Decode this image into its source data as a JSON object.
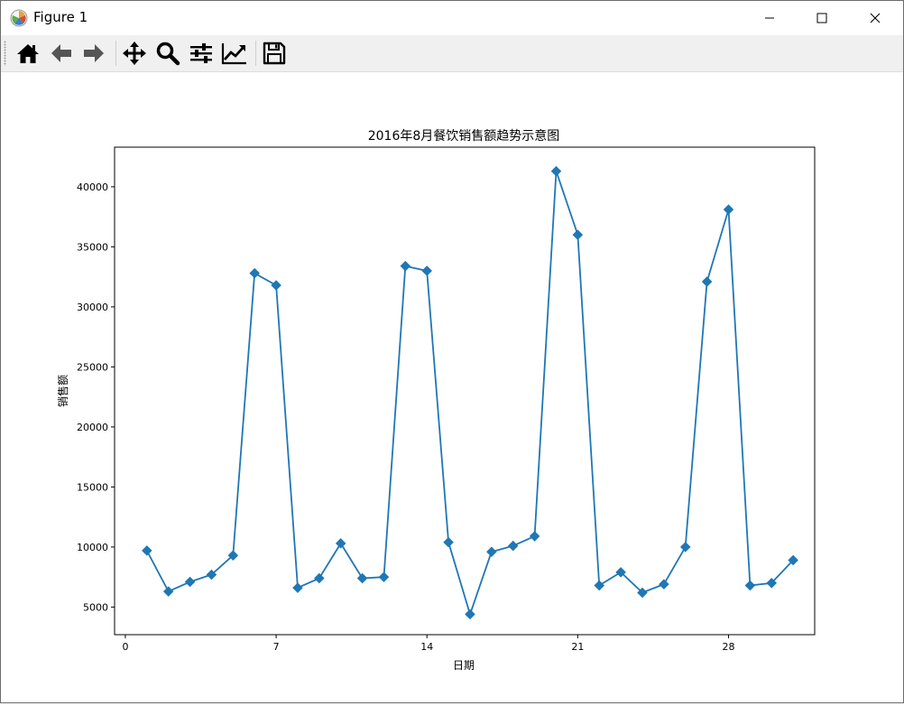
{
  "window": {
    "title": "Figure 1"
  },
  "toolbar": {
    "buttons": [
      {
        "name": "home-icon"
      },
      {
        "name": "back-arrow-icon"
      },
      {
        "name": "forward-arrow-icon"
      },
      {
        "name": "pan-move-icon"
      },
      {
        "name": "zoom-magnifier-icon"
      },
      {
        "name": "subplots-config-icon"
      },
      {
        "name": "edit-axes-icon"
      },
      {
        "name": "save-floppy-icon"
      }
    ]
  },
  "chart_data": {
    "type": "line",
    "title": "2016年8月餐饮销售额趋势示意图",
    "xlabel": "日期",
    "ylabel": "销售额",
    "xlim": [
      -0.5,
      32
    ],
    "ylim": [
      2700,
      43300
    ],
    "xticks": [
      0,
      7,
      14,
      21,
      28
    ],
    "yticks": [
      5000,
      10000,
      15000,
      20000,
      25000,
      30000,
      35000,
      40000
    ],
    "marker": "D",
    "line_color": "#1f77b4",
    "grid": false,
    "x": [
      1,
      2,
      3,
      4,
      5,
      6,
      7,
      8,
      9,
      10,
      11,
      12,
      13,
      14,
      15,
      16,
      17,
      18,
      19,
      20,
      21,
      22,
      23,
      24,
      25,
      26,
      27,
      28,
      29,
      30,
      31
    ],
    "values": [
      9700,
      6300,
      7100,
      7700,
      9300,
      32800,
      31800,
      6600,
      7400,
      10300,
      7400,
      7500,
      33400,
      33000,
      10400,
      4400,
      9600,
      10100,
      10900,
      41300,
      36000,
      6800,
      7900,
      6200,
      6900,
      10000,
      32100,
      38100,
      6800,
      7000,
      8900
    ]
  }
}
